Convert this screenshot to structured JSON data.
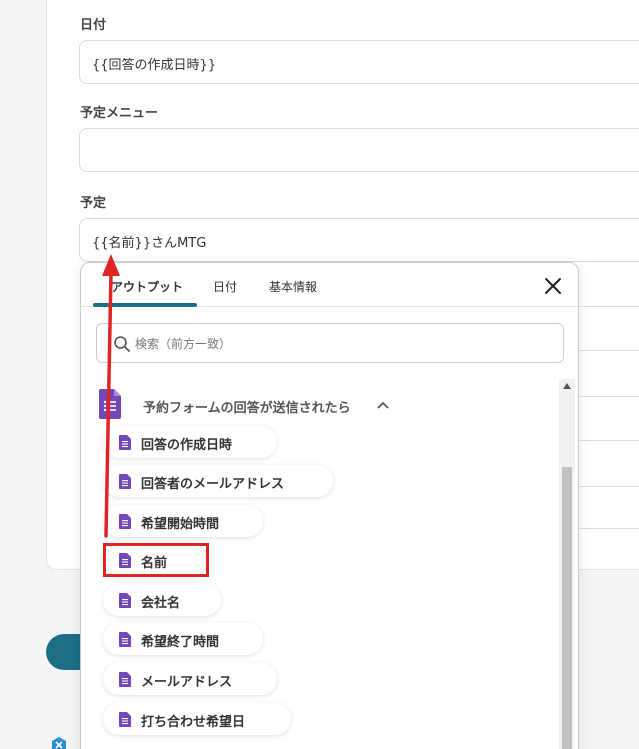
{
  "form": {
    "date_label": "日付",
    "date_value": "{{回答の作成日時}}",
    "menu_label": "予定メニュー",
    "menu_value": "",
    "schedule_label": "予定",
    "schedule_value": "{{名前}}さんMTG"
  },
  "popup": {
    "tabs": [
      {
        "label": "アウトプット",
        "active": true
      },
      {
        "label": "日付",
        "active": false
      },
      {
        "label": "基本情報",
        "active": false
      }
    ],
    "search_placeholder": "検索（前方一致）",
    "group_title": "予約フォームの回答が送信されたら",
    "items": [
      {
        "label": "回答の作成日時"
      },
      {
        "label": "回答者のメールアドレス"
      },
      {
        "label": "希望開始時間"
      },
      {
        "label": "名前",
        "highlighted": true
      },
      {
        "label": "会社名"
      },
      {
        "label": "希望終了時間"
      },
      {
        "label": "メールアドレス"
      },
      {
        "label": "打ち合わせ希望日"
      }
    ]
  },
  "icons": {
    "close": "close-icon",
    "search": "search-icon",
    "group": "google-forms-icon",
    "item": "form-field-icon",
    "chevron": "chevron-up-icon"
  },
  "colors": {
    "accent": "#1d6f86",
    "forms_purple": "#7248b9",
    "annotation_red": "#e02424"
  }
}
